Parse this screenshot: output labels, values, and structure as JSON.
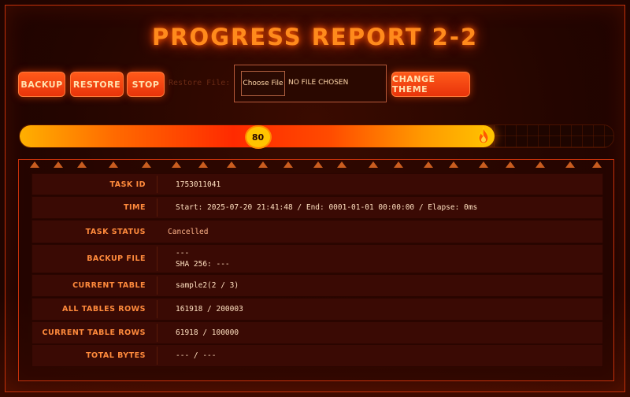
{
  "title": "PROGRESS REPORT 2-2",
  "toolbar": {
    "backup": "BACKUP",
    "restore": "RESTORE",
    "stop": "STOP",
    "restore_file_label": "Restore File:",
    "choose_file": "Choose File",
    "no_file": "NO FILE CHOSEN",
    "change_theme": "CHANGE THEME"
  },
  "progress": {
    "value": 80,
    "fill_fraction": 0.8,
    "icon": "flame-icon"
  },
  "report": {
    "task_id": {
      "label": "TASK ID",
      "value": "1753011041"
    },
    "time": {
      "label": "TIME",
      "value": "Start: 2025-07-20 21:41:48 / End: 0001-01-01 00:00:00 / Elapse: 0ms"
    },
    "task_status": {
      "label": "TASK STATUS",
      "value": "Cancelled"
    },
    "backup_file": {
      "label": "BACKUP FILE",
      "value": "---",
      "sha": "SHA 256: ---"
    },
    "current_table": {
      "label": "CURRENT TABLE",
      "value": "sample2(2 / 3)"
    },
    "all_tables_rows": {
      "label": "ALL TABLES ROWS",
      "value": "161918 / 200003"
    },
    "current_table_rows": {
      "label": "CURRENT TABLE ROWS",
      "value": "61918 / 100000"
    },
    "total_bytes": {
      "label": "TOTAL BYTES",
      "value": "--- / ---"
    }
  },
  "colors": {
    "accent": "#ff5a1a",
    "title": "#ff8a1c",
    "label": "#ff8a3c",
    "panel_border": "#c4300a"
  }
}
